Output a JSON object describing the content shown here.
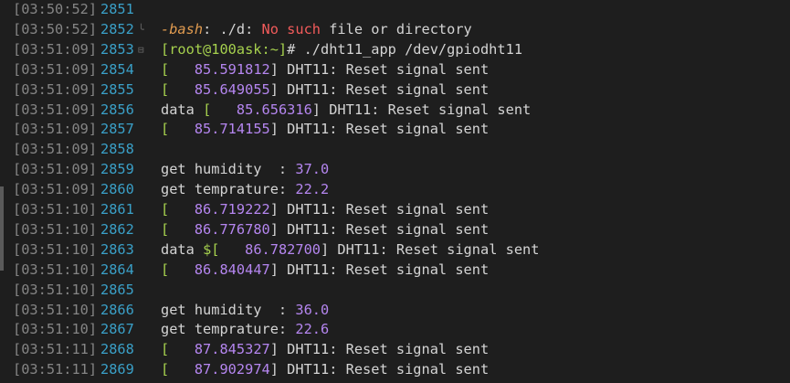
{
  "terminal": {
    "fold_box_glyph": "⊟",
    "lines": [
      {
        "ts": "[03:50:52]",
        "ln": "2851",
        "segments": []
      },
      {
        "ts": "[03:50:52]",
        "ln": "2852",
        "fold": "╰",
        "segments": [
          {
            "t": "-bash",
            "c": "c-italic-orange"
          },
          {
            "t": ": ./d: ",
            "c": "c-default"
          },
          {
            "t": "No such",
            "c": "c-red"
          },
          {
            "t": " file or directory",
            "c": "c-default"
          }
        ]
      },
      {
        "ts": "[03:51:09]",
        "ln": "2853",
        "fold": "⊟",
        "segments": [
          {
            "t": "[root@100ask:~]",
            "c": "c-green"
          },
          {
            "t": "# ./dht11_app /dev/gpiodht11",
            "c": "c-default"
          }
        ]
      },
      {
        "ts": "[03:51:09]",
        "ln": "2854",
        "segments": [
          {
            "t": "[",
            "c": "c-bracket"
          },
          {
            "t": "   85.591812",
            "c": "c-num"
          },
          {
            "t": "] DHT11: Reset signal sent",
            "c": "c-default"
          }
        ]
      },
      {
        "ts": "[03:51:09]",
        "ln": "2855",
        "segments": [
          {
            "t": "[",
            "c": "c-bracket"
          },
          {
            "t": "   85.649055",
            "c": "c-num"
          },
          {
            "t": "] DHT11: Reset signal sent",
            "c": "c-default"
          }
        ]
      },
      {
        "ts": "[03:51:09]",
        "ln": "2856",
        "segments": [
          {
            "t": "data ",
            "c": "c-default"
          },
          {
            "t": "[",
            "c": "c-bracket"
          },
          {
            "t": "   85.656316",
            "c": "c-num"
          },
          {
            "t": "] DHT11: Reset signal sent",
            "c": "c-default"
          }
        ]
      },
      {
        "ts": "[03:51:09]",
        "ln": "2857",
        "segments": [
          {
            "t": "[",
            "c": "c-bracket"
          },
          {
            "t": "   85.714155",
            "c": "c-num"
          },
          {
            "t": "] DHT11: Reset signal sent",
            "c": "c-default"
          }
        ]
      },
      {
        "ts": "[03:51:09]",
        "ln": "2858",
        "segments": []
      },
      {
        "ts": "[03:51:09]",
        "ln": "2859",
        "segments": [
          {
            "t": "get humidity  : ",
            "c": "c-default"
          },
          {
            "t": "37.0",
            "c": "c-num"
          }
        ]
      },
      {
        "ts": "[03:51:09]",
        "ln": "2860",
        "segments": [
          {
            "t": "get temprature: ",
            "c": "c-default"
          },
          {
            "t": "22.2",
            "c": "c-num"
          }
        ]
      },
      {
        "ts": "[03:51:10]",
        "ln": "2861",
        "segments": [
          {
            "t": "[",
            "c": "c-bracket"
          },
          {
            "t": "   86.719222",
            "c": "c-num"
          },
          {
            "t": "] DHT11: Reset signal sent",
            "c": "c-default"
          }
        ]
      },
      {
        "ts": "[03:51:10]",
        "ln": "2862",
        "segments": [
          {
            "t": "[",
            "c": "c-bracket"
          },
          {
            "t": "   86.776780",
            "c": "c-num"
          },
          {
            "t": "] DHT11: Reset signal sent",
            "c": "c-default"
          }
        ]
      },
      {
        "ts": "[03:51:10]",
        "ln": "2863",
        "segments": [
          {
            "t": "data ",
            "c": "c-default"
          },
          {
            "t": "$[",
            "c": "c-bracket"
          },
          {
            "t": "   86.782700",
            "c": "c-num"
          },
          {
            "t": "] DHT11: Reset signal sent",
            "c": "c-default"
          }
        ]
      },
      {
        "ts": "[03:51:10]",
        "ln": "2864",
        "segments": [
          {
            "t": "[",
            "c": "c-bracket"
          },
          {
            "t": "   86.840447",
            "c": "c-num"
          },
          {
            "t": "] DHT11: Reset signal sent",
            "c": "c-default"
          }
        ]
      },
      {
        "ts": "[03:51:10]",
        "ln": "2865",
        "segments": []
      },
      {
        "ts": "[03:51:10]",
        "ln": "2866",
        "segments": [
          {
            "t": "get humidity  : ",
            "c": "c-default"
          },
          {
            "t": "36.0",
            "c": "c-num"
          }
        ]
      },
      {
        "ts": "[03:51:10]",
        "ln": "2867",
        "segments": [
          {
            "t": "get temprature: ",
            "c": "c-default"
          },
          {
            "t": "22.6",
            "c": "c-num"
          }
        ]
      },
      {
        "ts": "[03:51:11]",
        "ln": "2868",
        "segments": [
          {
            "t": "[",
            "c": "c-bracket"
          },
          {
            "t": "   87.845327",
            "c": "c-num"
          },
          {
            "t": "] DHT11: Reset signal sent",
            "c": "c-default"
          }
        ]
      },
      {
        "ts": "[03:51:11]",
        "ln": "2869",
        "segments": [
          {
            "t": "[",
            "c": "c-bracket"
          },
          {
            "t": "   87.902974",
            "c": "c-num"
          },
          {
            "t": "] DHT11: Reset signal sent",
            "c": "c-default"
          }
        ]
      }
    ]
  }
}
